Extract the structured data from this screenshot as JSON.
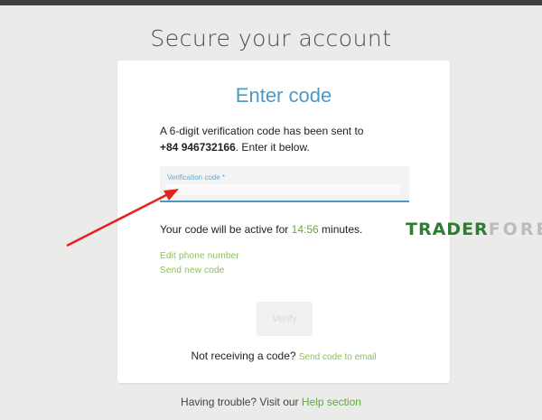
{
  "page": {
    "title": "Secure your account",
    "trouble_text": "Having trouble? Visit our",
    "help_link": "Help section"
  },
  "card": {
    "title": "Enter code",
    "description_line1": "A 6-digit verification code has been sent to",
    "phone": "+84 946732166",
    "description_line2": ". Enter it below.",
    "code_field": {
      "label": "Verification code *",
      "value": "",
      "placeholder": ""
    },
    "timer_prefix": "Your code will be active for",
    "timer_value": "14:56",
    "timer_suffix": "minutes.",
    "edit_phone_link": "Edit phone number",
    "send_new_code_link": "Send new code",
    "verify_button": "Verify",
    "not_receiving_text": "Not receiving a code?",
    "send_email_link": "Send code to email"
  },
  "watermark": {
    "part1": "TRADER",
    "part2": "FOREX"
  },
  "colors": {
    "accent_blue": "#4c9ac3",
    "accent_green": "#64a83c",
    "link_green": "#8cbf5c",
    "arrow_red": "#e8211c"
  }
}
